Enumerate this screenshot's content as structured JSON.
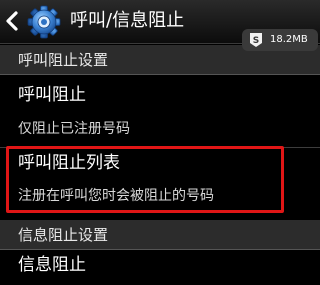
{
  "header": {
    "back_icon": "chevron-left-icon",
    "app_icon": "settings-gear-icon",
    "title": "呼叫/信息阻止"
  },
  "status": {
    "storage_icon": "s-badge-icon",
    "storage_text": "18.2MB"
  },
  "sections": {
    "call": {
      "header": "呼叫阻止设置",
      "items": [
        {
          "title": "呼叫阻止",
          "subtitle": "仅阻止已注册号码"
        },
        {
          "title": "呼叫阻止列表",
          "subtitle": "注册在呼叫您时会被阻止的号码"
        }
      ]
    },
    "message": {
      "header": "信息阻止设置",
      "items": [
        {
          "title": "信息阻止"
        }
      ]
    }
  },
  "colors": {
    "highlight_border": "#e01616",
    "header_background": "#2c2c2c",
    "background": "#000000"
  }
}
